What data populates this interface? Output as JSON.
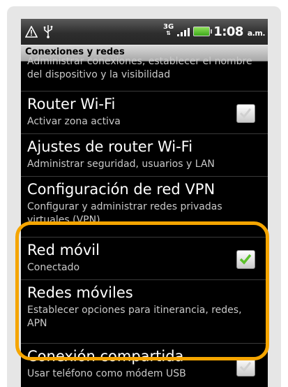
{
  "status_bar": {
    "network": "3G",
    "time": "1:08",
    "ampm": "a.m."
  },
  "header": {
    "title": "Conexiones y redes"
  },
  "items": [
    {
      "subtitle": "Administrar conexiones, establecer el nombre del dispositivo y la visibilidad"
    },
    {
      "title": "Router Wi-Fi",
      "subtitle": "Activar zona activa",
      "checked": false
    },
    {
      "title": "Ajustes de router Wi-Fi",
      "subtitle": "Administrar seguridad, usuarios y LAN"
    },
    {
      "title": "Configuración de red VPN",
      "subtitle": "Configurar y administrar redes privadas virtuales (VPN)"
    },
    {
      "title": "Red móvil",
      "subtitle": "Conectado",
      "checked": true
    },
    {
      "title": "Redes móviles",
      "subtitle": "Establecer opciones para itinerancia, redes, APN"
    },
    {
      "title": "Conexión compartida",
      "subtitle": "Usar teléfono como módem USB",
      "checked": false
    }
  ],
  "colors": {
    "highlight": "#f5a500",
    "check_on": "#5cc12a"
  }
}
